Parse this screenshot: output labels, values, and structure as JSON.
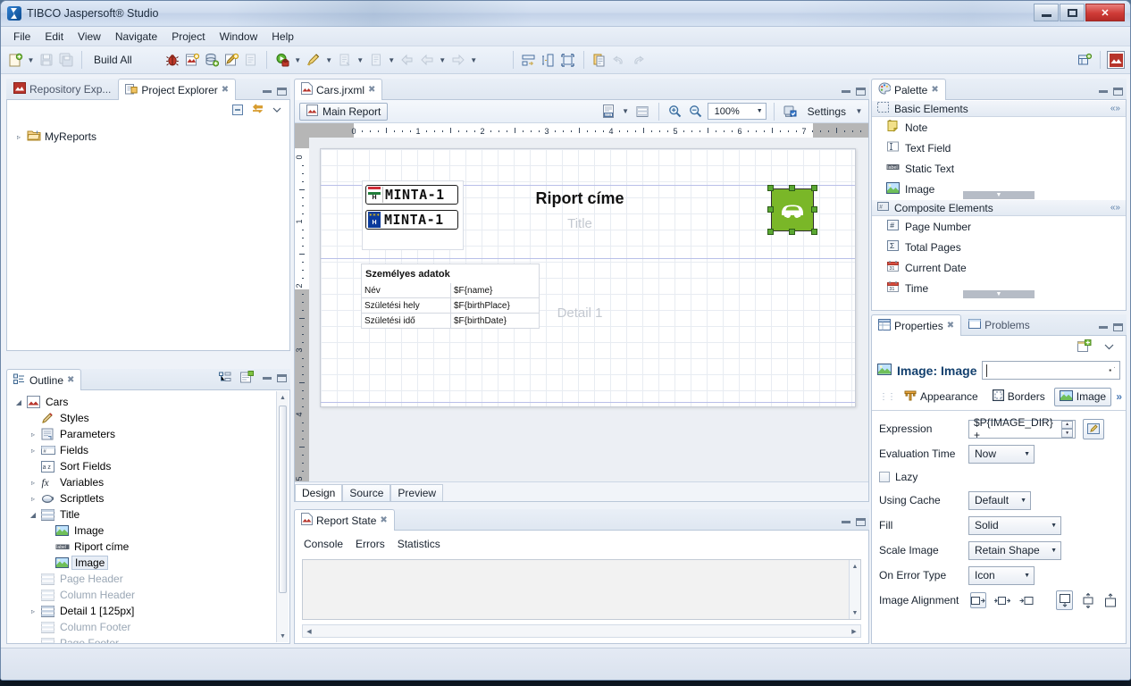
{
  "window": {
    "title": "TIBCO Jaspersoft® Studio",
    "logo_icon": "jaspersoft-logo-icon",
    "minimize": "–",
    "maximize": "□",
    "close": "✕"
  },
  "menubar": {
    "items": [
      "File",
      "Edit",
      "View",
      "Navigate",
      "Project",
      "Window",
      "Help"
    ]
  },
  "toolbar": {
    "build_label": "Build All",
    "icons": [
      "new-file-icon",
      "new-dropdown-arrow",
      "save-icon",
      "save-all-icon",
      "debug-icon",
      "new-report-icon",
      "new-datasource-icon",
      "new-style-icon",
      "new-blank-icon",
      "run-icon",
      "run-dropdown-arrow",
      "profile-icon",
      "profile-dropdown-arrow",
      "external-tools-icon",
      "external-tools-dropdown-arrow",
      "next-annotation-icon",
      "next-dropdown-arrow",
      "back-icon",
      "previous-icon",
      "previous-dropdown-arrow",
      "forward-icon",
      "forward-dropdown-arrow",
      "layout-icon",
      "split-icon",
      "fit-icon",
      "copy-icon",
      "undo-icon",
      "redo-icon"
    ],
    "perspective_icons": [
      "open-perspective-icon",
      "jaspersoft-perspective-icon"
    ]
  },
  "project_explorer": {
    "tabs": [
      {
        "label": "Repository Exp...",
        "icon": "repository-icon",
        "active": false
      },
      {
        "label": "Project Explorer",
        "icon": "project-explorer-icon",
        "active": true,
        "close": "✖"
      }
    ],
    "toolbar_icons": [
      "collapse-all-icon",
      "link-with-editor-icon",
      "view-menu-icon"
    ],
    "tree": [
      {
        "label": "MyReports",
        "icon": "folder-icon",
        "twisty": "▹",
        "indent": 0
      }
    ]
  },
  "outline": {
    "tab": {
      "label": "Outline",
      "icon": "outline-icon",
      "close": "✖"
    },
    "toolbar_icons": [
      "hierarchy-icon",
      "properties-view-icon"
    ],
    "nodes": [
      {
        "label": "Cars",
        "icon": "report-icon",
        "twisty": "◢",
        "indent": 0,
        "dim": false,
        "selected": false
      },
      {
        "label": "Styles",
        "icon": "styles-icon",
        "twisty": "",
        "indent": 1,
        "dim": false,
        "selected": false
      },
      {
        "label": "Parameters",
        "icon": "parameters-icon",
        "twisty": "▹",
        "indent": 1,
        "dim": false,
        "selected": false
      },
      {
        "label": "Fields",
        "icon": "fields-icon",
        "twisty": "▹",
        "indent": 1,
        "dim": false,
        "selected": false
      },
      {
        "label": "Sort Fields",
        "icon": "sort-fields-icon",
        "twisty": "",
        "indent": 1,
        "dim": false,
        "selected": false
      },
      {
        "label": "Variables",
        "icon": "variables-icon",
        "twisty": "▹",
        "indent": 1,
        "dim": false,
        "selected": false
      },
      {
        "label": "Scriptlets",
        "icon": "scriptlets-icon",
        "twisty": "▹",
        "indent": 1,
        "dim": false,
        "selected": false
      },
      {
        "label": "Title",
        "icon": "band-icon",
        "twisty": "◢",
        "indent": 1,
        "dim": false,
        "selected": false
      },
      {
        "label": "Image",
        "icon": "image-icon",
        "twisty": "",
        "indent": 2,
        "dim": false,
        "selected": false
      },
      {
        "label": "Riport címe",
        "icon": "static-text-icon",
        "twisty": "",
        "indent": 2,
        "dim": false,
        "selected": false
      },
      {
        "label": "Image",
        "icon": "image-icon",
        "twisty": "",
        "indent": 2,
        "dim": false,
        "selected": true
      },
      {
        "label": "Page Header",
        "icon": "band-icon",
        "twisty": "",
        "indent": 1,
        "dim": true,
        "selected": false
      },
      {
        "label": "Column Header",
        "icon": "band-icon",
        "twisty": "",
        "indent": 1,
        "dim": true,
        "selected": false
      },
      {
        "label": "Detail 1 [125px]",
        "icon": "band-icon",
        "twisty": "▹",
        "indent": 1,
        "dim": false,
        "selected": false
      },
      {
        "label": "Column Footer",
        "icon": "band-icon",
        "twisty": "",
        "indent": 1,
        "dim": true,
        "selected": false
      },
      {
        "label": "Page Footer",
        "icon": "band-icon",
        "twisty": "",
        "indent": 1,
        "dim": true,
        "selected": false
      }
    ]
  },
  "editor": {
    "tab": {
      "label": "Cars.jrxml",
      "icon": "jrxml-file-icon",
      "close": "✖"
    },
    "main_report_button": "Main Report",
    "zoom_level": "100%",
    "settings_label": "Settings",
    "toolbar_icons": [
      "dataset-icon",
      "dataset-dropdown-arrow",
      "bands-icon",
      "zoom-in-icon",
      "zoom-out-icon",
      "settings-icon",
      "settings-dropdown-arrow"
    ],
    "ruler_h_ticks": [
      "0",
      "1",
      "2",
      "3",
      "4",
      "5",
      "6",
      "7"
    ],
    "ruler_v_ticks": [
      "0",
      "1",
      "2",
      "3",
      "4",
      "5"
    ],
    "design_tabs": [
      {
        "label": "Design",
        "active": true
      },
      {
        "label": "Source",
        "active": false
      },
      {
        "label": "Preview",
        "active": false
      }
    ],
    "canvas": {
      "title_text": "Riport címe",
      "title_band_label": "Title",
      "detail_band_label": "Detail 1",
      "plate_text": "MINTA-1",
      "plates": [
        {
          "text": "MINTA-1",
          "flag": "hungary-flag-icon"
        },
        {
          "text": "MINTA-1",
          "flag": "eu-flag-icon"
        }
      ],
      "car_image_icon": "car-image-icon",
      "table": {
        "heading": "Személyes adatok",
        "rows": [
          {
            "label": "Név",
            "value": "$F{name}"
          },
          {
            "label": "Születési hely",
            "value": "$F{birthPlace}"
          },
          {
            "label": "Születési idő",
            "value": "$F{birthDate}"
          }
        ]
      }
    }
  },
  "report_state": {
    "tab": {
      "label": "Report State",
      "icon": "report-state-icon",
      "close": "✖"
    },
    "tabs": [
      "Console",
      "Errors",
      "Statistics"
    ],
    "console_text": ""
  },
  "palette": {
    "tab": {
      "label": "Palette",
      "icon": "palette-icon",
      "close": "✖"
    },
    "groups": [
      {
        "label": "Basic Elements",
        "icon": "basic-elements-icon",
        "collapse_icon": "collapse-group-icon",
        "items": [
          {
            "label": "Note",
            "icon": "note-icon"
          },
          {
            "label": "Text Field",
            "icon": "text-field-icon"
          },
          {
            "label": "Static Text",
            "icon": "static-text-icon"
          },
          {
            "label": "Image",
            "icon": "image-icon"
          }
        ]
      },
      {
        "label": "Composite Elements",
        "icon": "composite-elements-icon",
        "collapse_icon": "collapse-group-icon",
        "items": [
          {
            "label": "Page Number",
            "icon": "page-number-icon"
          },
          {
            "label": "Total Pages",
            "icon": "total-pages-icon"
          },
          {
            "label": "Current Date",
            "icon": "current-date-icon"
          },
          {
            "label": "Time",
            "icon": "time-icon"
          }
        ]
      }
    ]
  },
  "properties": {
    "tabs": [
      {
        "label": "Properties",
        "icon": "properties-icon",
        "active": true,
        "close": "✖"
      },
      {
        "label": "Problems",
        "icon": "problems-icon",
        "active": false
      }
    ],
    "toolbar_icons": [
      "pin-properties-icon",
      "view-menu-icon"
    ],
    "element_title": "Image: Image",
    "element_icon": "image-icon",
    "name_value": "",
    "name_placeholder": "",
    "section_tabs": [
      {
        "label": "Appearance",
        "icon": "appearance-icon",
        "active": false
      },
      {
        "label": "Borders",
        "icon": "borders-icon",
        "active": false
      },
      {
        "label": "Image",
        "icon": "image-icon",
        "active": true
      }
    ],
    "more_tabs": "»",
    "fields": {
      "expression_label": "Expression",
      "expression_value": "$P{IMAGE_DIR} + ",
      "expression_edit_icon": "edit-expression-icon",
      "evaluation_time_label": "Evaluation Time",
      "evaluation_time_value": "Now",
      "lazy_label": "Lazy",
      "lazy_checked": false,
      "using_cache_label": "Using Cache",
      "using_cache_value": "Default",
      "fill_label": "Fill",
      "fill_value": "Solid",
      "scale_image_label": "Scale Image",
      "scale_image_value": "Retain Shape",
      "on_error_type_label": "On Error Type",
      "on_error_type_value": "Icon",
      "image_alignment_label": "Image Alignment",
      "h_align_icons": [
        "align-left-icon",
        "align-center-icon",
        "align-right-icon"
      ],
      "v_align_icons": [
        "align-top-icon",
        "align-middle-icon",
        "align-bottom-icon"
      ],
      "h_align_selected": 0,
      "v_align_selected": 0
    }
  },
  "colors": {
    "accent": "#13406e",
    "title_bar": "#cfdcee",
    "close_button": "#cf3b37",
    "selection_handle": "#5aa832",
    "car_green": "#7ab728"
  }
}
